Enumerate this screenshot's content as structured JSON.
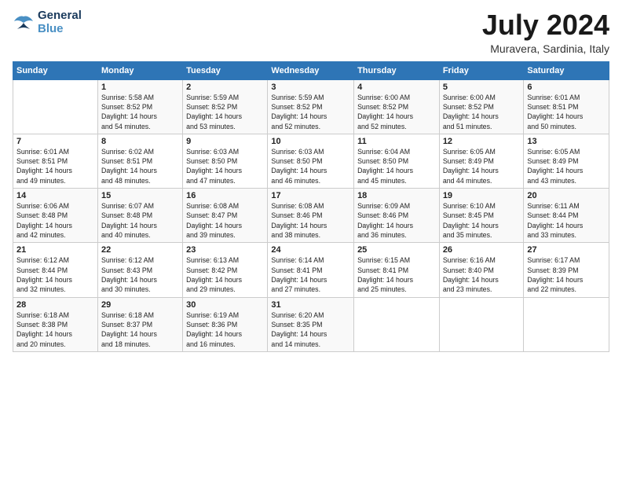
{
  "logo": {
    "line1": "General",
    "line2": "Blue"
  },
  "title": "July 2024",
  "location": "Muravera, Sardinia, Italy",
  "days_header": [
    "Sunday",
    "Monday",
    "Tuesday",
    "Wednesday",
    "Thursday",
    "Friday",
    "Saturday"
  ],
  "weeks": [
    [
      {
        "day": "",
        "info": ""
      },
      {
        "day": "1",
        "info": "Sunrise: 5:58 AM\nSunset: 8:52 PM\nDaylight: 14 hours\nand 54 minutes."
      },
      {
        "day": "2",
        "info": "Sunrise: 5:59 AM\nSunset: 8:52 PM\nDaylight: 14 hours\nand 53 minutes."
      },
      {
        "day": "3",
        "info": "Sunrise: 5:59 AM\nSunset: 8:52 PM\nDaylight: 14 hours\nand 52 minutes."
      },
      {
        "day": "4",
        "info": "Sunrise: 6:00 AM\nSunset: 8:52 PM\nDaylight: 14 hours\nand 52 minutes."
      },
      {
        "day": "5",
        "info": "Sunrise: 6:00 AM\nSunset: 8:52 PM\nDaylight: 14 hours\nand 51 minutes."
      },
      {
        "day": "6",
        "info": "Sunrise: 6:01 AM\nSunset: 8:51 PM\nDaylight: 14 hours\nand 50 minutes."
      }
    ],
    [
      {
        "day": "7",
        "info": "Sunrise: 6:01 AM\nSunset: 8:51 PM\nDaylight: 14 hours\nand 49 minutes."
      },
      {
        "day": "8",
        "info": "Sunrise: 6:02 AM\nSunset: 8:51 PM\nDaylight: 14 hours\nand 48 minutes."
      },
      {
        "day": "9",
        "info": "Sunrise: 6:03 AM\nSunset: 8:50 PM\nDaylight: 14 hours\nand 47 minutes."
      },
      {
        "day": "10",
        "info": "Sunrise: 6:03 AM\nSunset: 8:50 PM\nDaylight: 14 hours\nand 46 minutes."
      },
      {
        "day": "11",
        "info": "Sunrise: 6:04 AM\nSunset: 8:50 PM\nDaylight: 14 hours\nand 45 minutes."
      },
      {
        "day": "12",
        "info": "Sunrise: 6:05 AM\nSunset: 8:49 PM\nDaylight: 14 hours\nand 44 minutes."
      },
      {
        "day": "13",
        "info": "Sunrise: 6:05 AM\nSunset: 8:49 PM\nDaylight: 14 hours\nand 43 minutes."
      }
    ],
    [
      {
        "day": "14",
        "info": "Sunrise: 6:06 AM\nSunset: 8:48 PM\nDaylight: 14 hours\nand 42 minutes."
      },
      {
        "day": "15",
        "info": "Sunrise: 6:07 AM\nSunset: 8:48 PM\nDaylight: 14 hours\nand 40 minutes."
      },
      {
        "day": "16",
        "info": "Sunrise: 6:08 AM\nSunset: 8:47 PM\nDaylight: 14 hours\nand 39 minutes."
      },
      {
        "day": "17",
        "info": "Sunrise: 6:08 AM\nSunset: 8:46 PM\nDaylight: 14 hours\nand 38 minutes."
      },
      {
        "day": "18",
        "info": "Sunrise: 6:09 AM\nSunset: 8:46 PM\nDaylight: 14 hours\nand 36 minutes."
      },
      {
        "day": "19",
        "info": "Sunrise: 6:10 AM\nSunset: 8:45 PM\nDaylight: 14 hours\nand 35 minutes."
      },
      {
        "day": "20",
        "info": "Sunrise: 6:11 AM\nSunset: 8:44 PM\nDaylight: 14 hours\nand 33 minutes."
      }
    ],
    [
      {
        "day": "21",
        "info": "Sunrise: 6:12 AM\nSunset: 8:44 PM\nDaylight: 14 hours\nand 32 minutes."
      },
      {
        "day": "22",
        "info": "Sunrise: 6:12 AM\nSunset: 8:43 PM\nDaylight: 14 hours\nand 30 minutes."
      },
      {
        "day": "23",
        "info": "Sunrise: 6:13 AM\nSunset: 8:42 PM\nDaylight: 14 hours\nand 29 minutes."
      },
      {
        "day": "24",
        "info": "Sunrise: 6:14 AM\nSunset: 8:41 PM\nDaylight: 14 hours\nand 27 minutes."
      },
      {
        "day": "25",
        "info": "Sunrise: 6:15 AM\nSunset: 8:41 PM\nDaylight: 14 hours\nand 25 minutes."
      },
      {
        "day": "26",
        "info": "Sunrise: 6:16 AM\nSunset: 8:40 PM\nDaylight: 14 hours\nand 23 minutes."
      },
      {
        "day": "27",
        "info": "Sunrise: 6:17 AM\nSunset: 8:39 PM\nDaylight: 14 hours\nand 22 minutes."
      }
    ],
    [
      {
        "day": "28",
        "info": "Sunrise: 6:18 AM\nSunset: 8:38 PM\nDaylight: 14 hours\nand 20 minutes."
      },
      {
        "day": "29",
        "info": "Sunrise: 6:18 AM\nSunset: 8:37 PM\nDaylight: 14 hours\nand 18 minutes."
      },
      {
        "day": "30",
        "info": "Sunrise: 6:19 AM\nSunset: 8:36 PM\nDaylight: 14 hours\nand 16 minutes."
      },
      {
        "day": "31",
        "info": "Sunrise: 6:20 AM\nSunset: 8:35 PM\nDaylight: 14 hours\nand 14 minutes."
      },
      {
        "day": "",
        "info": ""
      },
      {
        "day": "",
        "info": ""
      },
      {
        "day": "",
        "info": ""
      }
    ]
  ]
}
